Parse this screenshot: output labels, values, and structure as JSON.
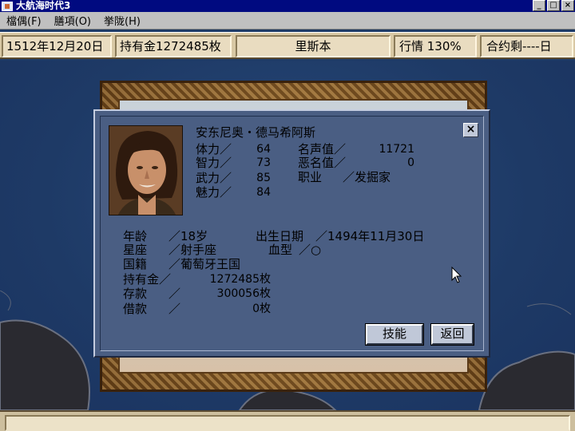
{
  "window": {
    "title": "大航海时代3",
    "controls": [
      "_",
      "□",
      "×"
    ]
  },
  "menu": [
    "檔偶(F)",
    "膳項(O)",
    "挙陇(H)"
  ],
  "status": {
    "date": "1512年12月20日",
    "money": "持有金1272485枚",
    "port": "里斯本",
    "market": "行情 130%",
    "contract": "合约剩----日"
  },
  "character": {
    "name": "安东尼奥・德马希阿斯",
    "stats": [
      {
        "label": "体力／",
        "value": "64"
      },
      {
        "label": "智力／",
        "value": "73"
      },
      {
        "label": "武力／",
        "value": "85"
      },
      {
        "label": "魅力／",
        "value": "84"
      }
    ],
    "fame_label": "名声值／",
    "fame_value": "11721",
    "notoriety_label": "恶名值／",
    "notoriety_value": "0",
    "job_label": "职业",
    "job_value": "／发掘家",
    "age_label": "年龄",
    "age_value": "／18岁",
    "birth_label": "出生日期",
    "birth_value": "／1494年11月30日",
    "zodiac_label": "星座",
    "zodiac_value": "／射手座",
    "blood_label": "血型",
    "blood_value": "／○",
    "nation_label": "国籍",
    "nation_value": "／葡萄牙王国",
    "gold_label": "持有金／",
    "gold_value": "1272485枚",
    "deposit_label": "存款",
    "deposit_slash": "／",
    "deposit_value": "300056枚",
    "loan_label": "借款",
    "loan_slash": "／",
    "loan_value": "0枚"
  },
  "buttons": {
    "skills": "技能",
    "back": "返回",
    "close": "×"
  }
}
